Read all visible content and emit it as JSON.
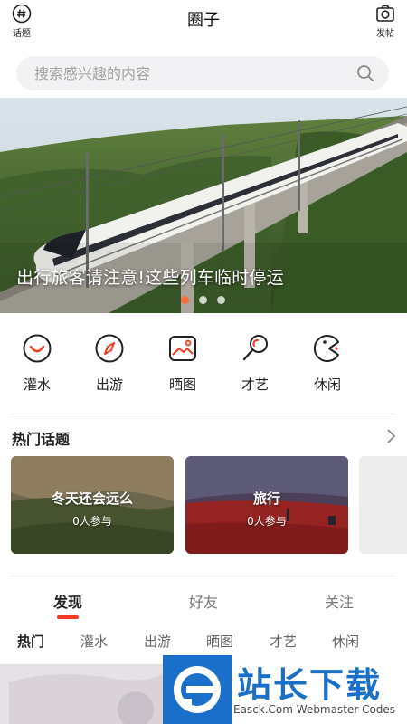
{
  "header": {
    "title": "圈子",
    "topics_label": "话题",
    "post_label": "发帖"
  },
  "search": {
    "placeholder": "搜索感兴趣的内容"
  },
  "banner": {
    "caption": "出行旅客请注意!这些列车临时停运",
    "slides": 3,
    "active_slide": 1
  },
  "categories": [
    {
      "label": "灌水",
      "icon": "smile-icon"
    },
    {
      "label": "出游",
      "icon": "compass-icon"
    },
    {
      "label": "晒图",
      "icon": "image-icon"
    },
    {
      "label": "才艺",
      "icon": "microphone-icon"
    },
    {
      "label": "休闲",
      "icon": "pacman-icon"
    }
  ],
  "hot_topics": {
    "title": "热门话题",
    "items": [
      {
        "name": "冬天还会远么",
        "count": "0人参与"
      },
      {
        "name": "旅行",
        "count": "0人参与"
      }
    ]
  },
  "tabs": [
    {
      "label": "发现",
      "active": true
    },
    {
      "label": "好友",
      "active": false
    },
    {
      "label": "关注",
      "active": false
    }
  ],
  "sub_tabs": [
    {
      "label": "热门",
      "active": true
    },
    {
      "label": "灌水",
      "active": false
    },
    {
      "label": "出游",
      "active": false
    },
    {
      "label": "晒图",
      "active": false
    },
    {
      "label": "才艺",
      "active": false
    },
    {
      "label": "休闲",
      "active": false
    }
  ],
  "watermark": {
    "title": "站长下载",
    "subtitle": "Easck.Com Webmaster Codes"
  },
  "colors": {
    "accent": "#ef3b1f",
    "dot_active": "#ff6a3d",
    "watermark_blue": "#1a6fc9"
  }
}
